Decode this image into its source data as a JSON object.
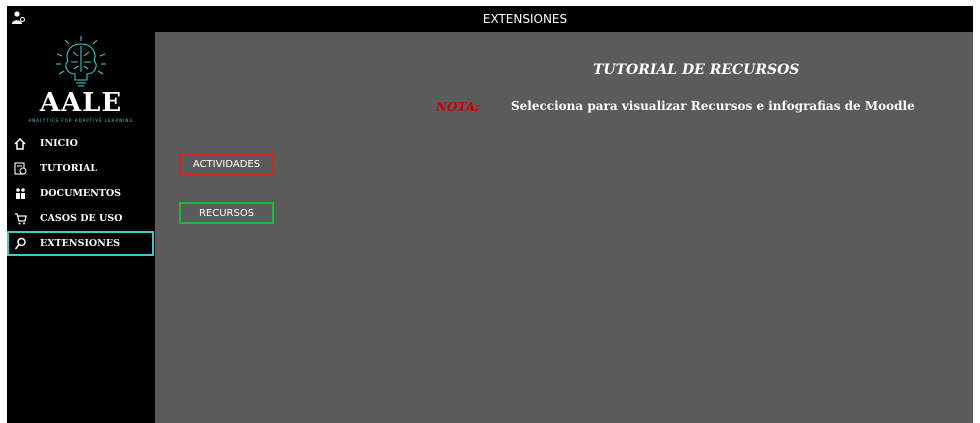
{
  "window": {
    "title": "EXTENSIONES",
    "icon": "app-user-icon"
  },
  "logo": {
    "text": "AALE",
    "subtitle": "ANALYTICS FOR ADAPTIVE LEARNING",
    "icon": "brain-circuit-icon",
    "accent_color": "#3fc9c9"
  },
  "sidebar": {
    "items": [
      {
        "label": "INICIO",
        "icon": "home-icon"
      },
      {
        "label": "TUTORIAL",
        "icon": "tutorial-icon"
      },
      {
        "label": "DOCUMENTOS",
        "icon": "documents-icon"
      },
      {
        "label": "CASOS DE USO",
        "icon": "cart-icon"
      },
      {
        "label": "EXTENSIONES",
        "icon": "search-icon",
        "active": true
      }
    ]
  },
  "main": {
    "heading": "TUTORIAL DE RECURSOS",
    "nota_label": "NOTA:",
    "nota_text": "Selecciona para visualizar Recursos e infografias de Moodle",
    "buttons": {
      "actividades": "ACTIVIDADES",
      "recursos": "RECURSOS"
    }
  },
  "colors": {
    "background": "#5b5b5b",
    "sidebar": "#000000",
    "nota": "#d00000",
    "actividades_border": "#d42424",
    "recursos_border": "#20b83a",
    "active_border": "#3fc9c9"
  }
}
